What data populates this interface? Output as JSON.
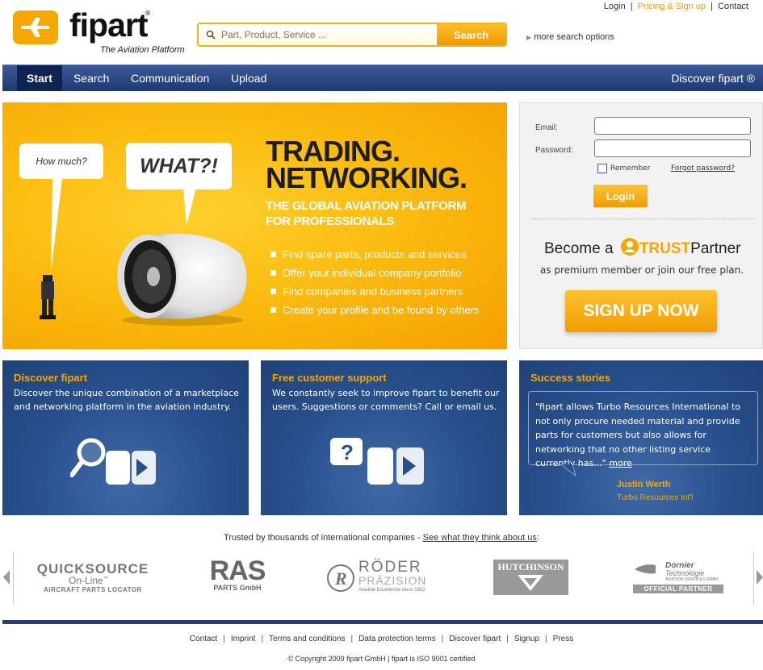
{
  "colors": {
    "accent": "#f5a700",
    "nav": "#1e3a75",
    "box": "#284f8c"
  },
  "header": {
    "logo_text": "fipart",
    "logo_reg": "®",
    "logo_subtitle": "The Aviation Platform",
    "search_placeholder": "Part, Product, Service ...",
    "search_button": "Search",
    "more_options": "more search options",
    "top_links": [
      "Login",
      "Pricing & Sign up",
      "Contact"
    ]
  },
  "nav": {
    "items": [
      "Start",
      "Search",
      "Communication",
      "Upload"
    ],
    "right": "Discover fipart ®"
  },
  "hero": {
    "bubble1": "How much?",
    "bubble2": "WHAT?!",
    "headline1": "TRADING.",
    "headline2": "NETWORKING.",
    "subline1": "THE GLOBAL AVIATION PLATFORM",
    "subline2": "FOR PROFESSIONALS",
    "bullets": [
      "Find spare parts, products and services",
      "Offer your individual company portfolio",
      "Find companies and business partners",
      "Create your profile and be found by others"
    ]
  },
  "login": {
    "email_label": "Email:",
    "password_label": "Password:",
    "remember": "Remember",
    "forgot": "Forgot password?",
    "button": "Login",
    "become": "Become a",
    "trust": "TRUST",
    "partner": "Partner",
    "premium": "as premium member or join our free plan.",
    "signup": "SIGN UP NOW"
  },
  "boxes": [
    {
      "title": "Discover fipart",
      "text": "Discover the unique combination of a marketplace and networking platform in the aviation industry."
    },
    {
      "title": "Free customer support",
      "text": "We constantly seek to improve fipart to benefit our users. Suggestions or comments? Call or email us."
    },
    {
      "title": "Success stories",
      "quote": "\"fipart allows Turbo Resources International to not only procure needed material and provide parts for customers but also allows for networking that no other listing service currently has...\"",
      "more": "more",
      "author": "Justin Werth",
      "company": "Turbo Resources Int'l"
    }
  ],
  "trusted": {
    "text": "Trusted by thousands of international companies -",
    "link": "See what they think about us",
    "logos": {
      "quicksource": {
        "line1": "QUICKSOURCE",
        "line2": "On-Line",
        "tm": "™",
        "line3": "AIRCRAFT PARTS LOCATOR"
      },
      "ras": {
        "line1": "RAS",
        "line2": "PARTS GmbH"
      },
      "roeder": {
        "line1": "RÖDER",
        "line2": "PRÄZISION",
        "line3": "Aviation Excellence since 1922"
      },
      "hutchinson": {
        "line1": "HUTCHINSON"
      },
      "dornier": {
        "line1": "Dornier",
        "line2": "Technologie",
        "line3": "AVIATION SERVICES GMBH",
        "line4": "OFFICIAL PARTNER"
      }
    }
  },
  "footer": {
    "links": [
      "Contact",
      "Imprint",
      "Terms and conditions",
      "Data protection terms",
      "Discover fipart",
      "Signup",
      "Press"
    ],
    "copyright": "© Copyright 2009 fipart GmbH | fipart is ISO 9001 certified"
  }
}
